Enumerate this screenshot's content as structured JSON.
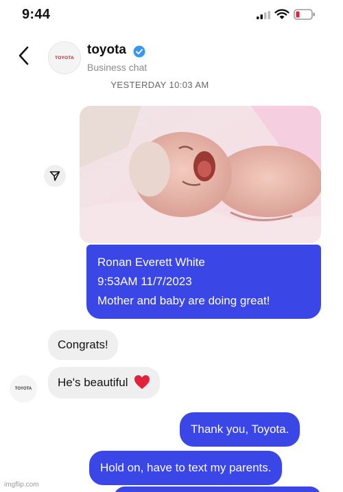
{
  "status_bar": {
    "time": "9:44",
    "icons": [
      "signal-icon",
      "wifi-icon",
      "battery-icon"
    ]
  },
  "header": {
    "avatar_logo": "TOYOTA",
    "name": "toyota",
    "verified_icon": "verified-badge-icon",
    "subtitle": "Business chat",
    "back_icon": "chevron-left-icon"
  },
  "timestamp": "YESTERDAY 10:03 AM",
  "messages": [
    {
      "type": "image",
      "direction": "sent",
      "description_icon": "photo"
    },
    {
      "type": "text",
      "direction": "sent",
      "lines": [
        "Ronan Everett White",
        "9:53AM 11/7/2023",
        "Mother and baby are doing great!"
      ]
    },
    {
      "type": "text",
      "direction": "received",
      "text": "Congrats!"
    },
    {
      "type": "text",
      "direction": "received",
      "text": "He's beautiful",
      "emoji": "heart-icon"
    },
    {
      "type": "text",
      "direction": "sent",
      "text": "Thank you, Toyota."
    },
    {
      "type": "text",
      "direction": "sent",
      "text": "Hold on, have to text my parents."
    }
  ],
  "received_avatar_logo": "TOYOTA",
  "watermark": "imgflip.com",
  "colors": {
    "sent_bubble": "#3a46e6",
    "received_bubble": "#efefef",
    "verified": "#3897f0",
    "heart": "#e0233a"
  }
}
